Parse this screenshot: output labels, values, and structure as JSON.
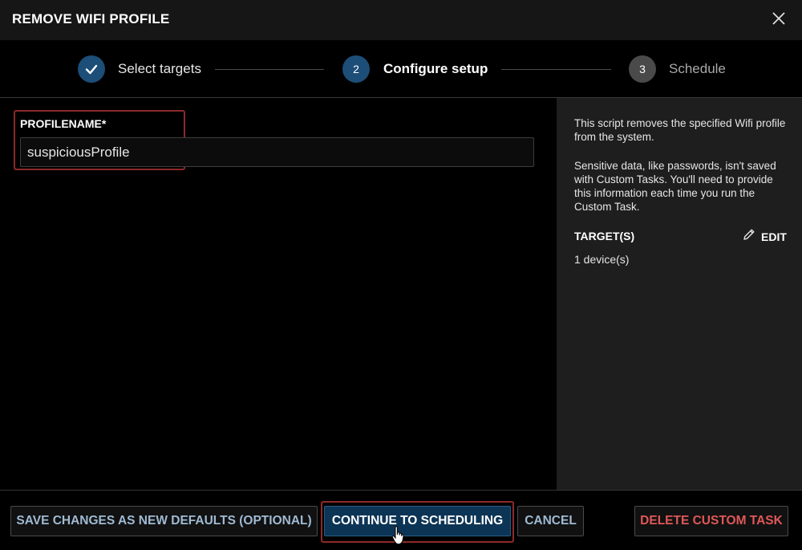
{
  "dialog": {
    "title": "REMOVE WIFI PROFILE",
    "close_icon": "close-icon"
  },
  "stepper": {
    "steps": [
      {
        "label": "Select targets",
        "state": "completed",
        "marker": "check-icon"
      },
      {
        "label": "Configure setup",
        "state": "active",
        "number": "2"
      },
      {
        "label": "Schedule",
        "state": "pending",
        "number": "3"
      }
    ]
  },
  "form": {
    "field_label": "PROFILENAME*",
    "field_value": "suspiciousProfile"
  },
  "sidebar": {
    "description_1": "This script removes the specified Wifi profile from the system.",
    "description_2": "Sensitive data, like passwords, isn't saved with Custom Tasks. You'll need to provide this information each time you run the Custom Task.",
    "targets_heading": "TARGET(S)",
    "edit_label": "EDIT",
    "edit_icon": "pencil-icon",
    "targets_count": "1 device(s)"
  },
  "footer": {
    "save_defaults_label": "SAVE CHANGES AS NEW DEFAULTS (OPTIONAL)",
    "continue_label": "CONTINUE TO SCHEDULING",
    "cancel_label": "CANCEL",
    "delete_label": "DELETE CUSTOM TASK"
  },
  "colors": {
    "background": "#000000",
    "panel": "#1e1e1e",
    "primary": "#0c3455",
    "step_active": "#1c4e78",
    "step_pending": "#4a4a4a",
    "link_text": "#9fbad3",
    "danger_text": "#e05757",
    "highlight": "#8c2a2a"
  }
}
